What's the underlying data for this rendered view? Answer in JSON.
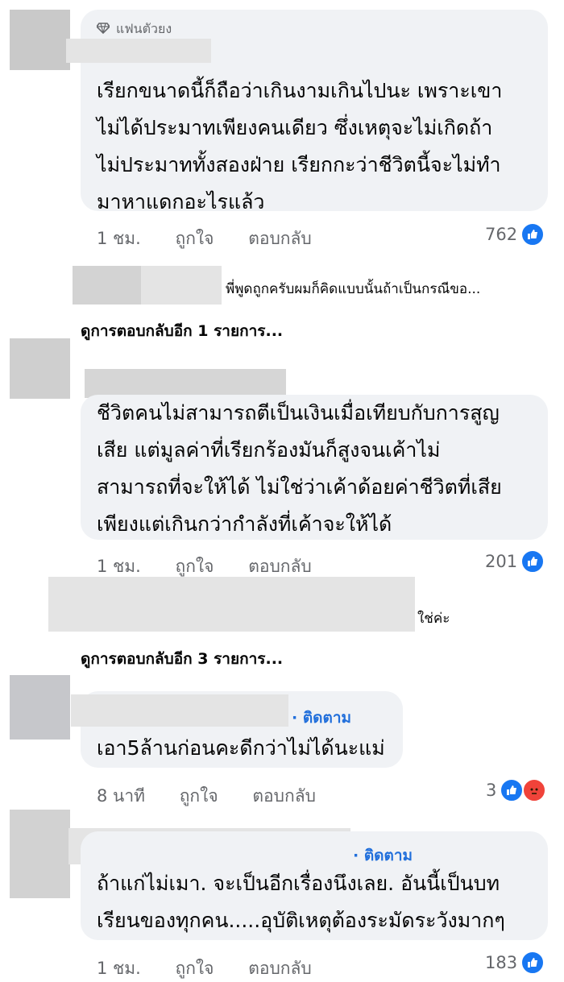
{
  "comments": [
    {
      "badge": "แฟนตัวยง",
      "text": "เรียกขนาดนี้ก็ถือว่าเกินงามเกินไปนะ เพราะเขา\nไม่ได้ประมาทเพียงคนเดียว ซึ่งเหตุจะไม่เกิดถ้า\nไม่ประมาททั้งสองฝ่าย เรียกกะว่าชีวิตนี้จะไม่ทำ\nมาหาแดกอะไรแล้ว",
      "time": "1 ชม.",
      "like": "ถูกใจ",
      "reply": "ตอบกลับ",
      "reactions": "762"
    },
    {
      "text": "ชีวิตคนไม่สามารถตีเป็นเงินเมื่อเทียบกับการสูญ\nเสีย  แต่มูลค่าที่เรียกร้องมันก็สูงจนเค้าไม่\nสามารถที่จะให้ได้ ไม่ใช่ว่าเค้าด้อยค่าชีวิตที่เสีย\nเพียงแต่เกินกว่ากำลังที่เค้าจะให้ได้",
      "time": "1 ชม.",
      "like": "ถูกใจ",
      "reply": "ตอบกลับ",
      "reactions": "201"
    },
    {
      "follow": "· ติดตาม",
      "text": "เอา5ล้านก่อนคะดีกว่าไม่ได้นะแม่",
      "time": "8 นาที",
      "like": "ถูกใจ",
      "reply": "ตอบกลับ",
      "reactions": "3"
    },
    {
      "follow": "· ติดตาม",
      "text": "ถ้าแก่ไม่เมา. จะเป็นอีกเรื่องนึงเลย. อันนี้เป็นบท\nเรียนของทุกคน.....อุบัติเหตุต้องระมัดระวังมากๆ",
      "time": "1 ชม.",
      "like": "ถูกใจ",
      "reply": "ตอบกลับ",
      "reactions": "183"
    }
  ],
  "replies": [
    {
      "snippet": "พี่พูดถูกครับผมก็คิดแบบนั้นถ้าเป็นกรณีขอ...",
      "more": "ดูการตอบกลับอีก 1 รายการ..."
    },
    {
      "snippet": "ใช่ค่ะ",
      "more": "ดูการตอบกลับอีก 3 รายการ..."
    }
  ],
  "colors": {
    "accent": "#1877f2",
    "follow": "#216fdb",
    "bubble": "#f0f2f5",
    "angry": "#f0433a"
  },
  "icons": {
    "badge": "diamond-icon",
    "like": "like-icon",
    "angry": "angry-icon"
  }
}
